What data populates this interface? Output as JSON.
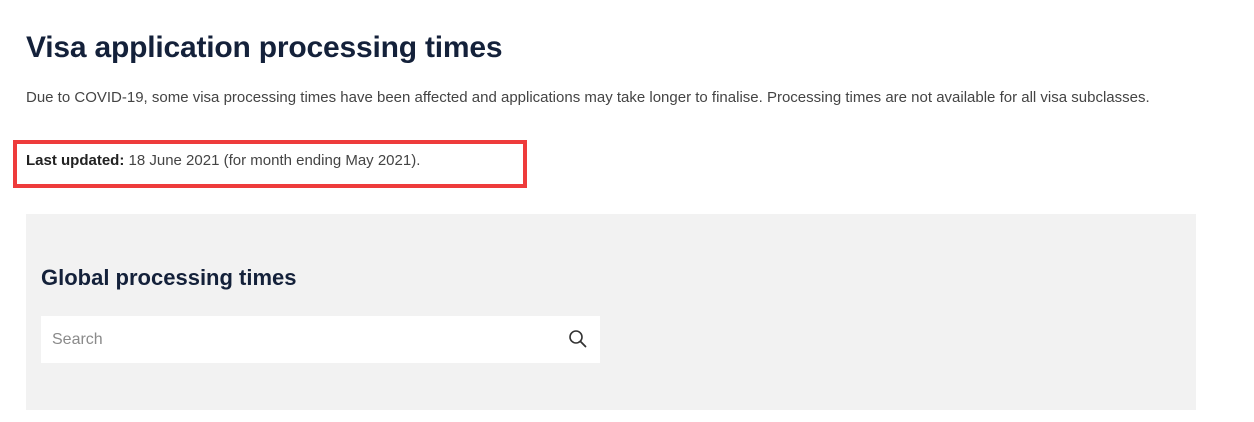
{
  "page": {
    "title": "Visa application processing times",
    "intro": "Due to COVID-19, some visa processing times have been affected and applications may take longer to finalise. Processing times are not available for all visa subclasses.",
    "last_updated_label": "Last updated:",
    "last_updated_value": " 18 June 2021 (for month ending May 2021)."
  },
  "highlight": {
    "color": "#ee3b3b"
  },
  "panel": {
    "title": "Global processing times",
    "background": "#f2f2f2",
    "search": {
      "placeholder": "Search",
      "value": "",
      "icon": "search-icon"
    }
  }
}
